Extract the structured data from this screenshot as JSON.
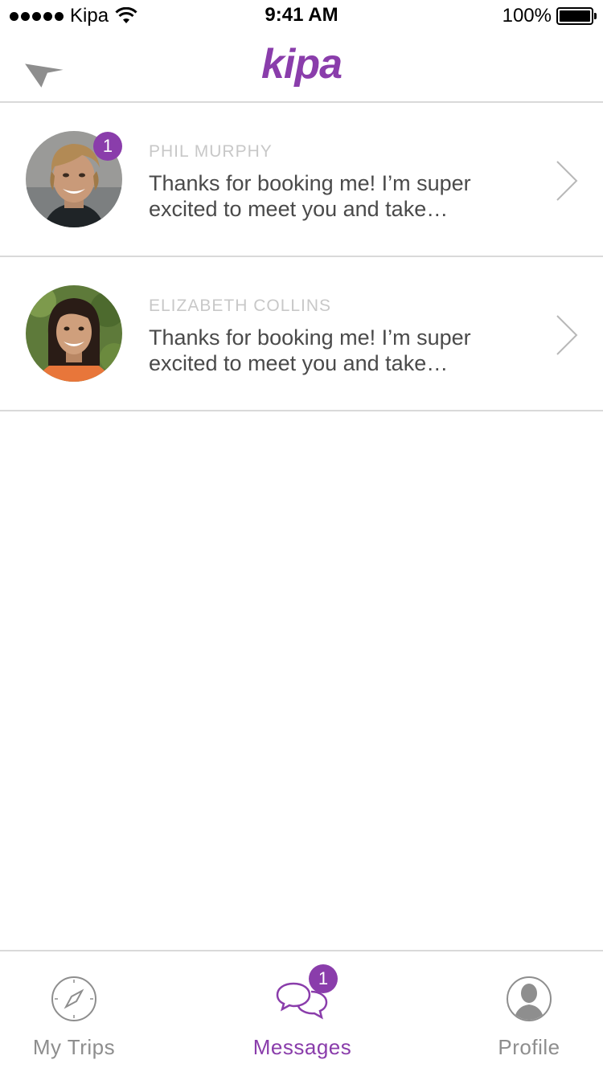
{
  "status_bar": {
    "carrier": "Kipa",
    "time": "9:41 AM",
    "battery": "100%"
  },
  "header": {
    "brand": "kipa",
    "left_icon": "location-arrow-icon"
  },
  "conversations": [
    {
      "name": "PHIL MURPHY",
      "preview": "Thanks for booking me! I’m super excited to meet you and take…",
      "unread": "1"
    },
    {
      "name": "ELIZABETH COLLINS",
      "preview": "Thanks for booking me! I’m super excited to meet you and take…",
      "unread": ""
    }
  ],
  "tab_bar": {
    "tabs": [
      {
        "label": "My Trips",
        "icon": "compass-icon",
        "active": false
      },
      {
        "label": "Messages",
        "icon": "chat-bubbles-icon",
        "active": true,
        "badge": "1"
      },
      {
        "label": "Profile",
        "icon": "profile-icon",
        "active": false
      }
    ]
  },
  "colors": {
    "accent": "#8a3dab",
    "divider": "#d9d9d9",
    "muted_text": "#c8c8c8",
    "inactive_tab": "#8e8e8e"
  }
}
